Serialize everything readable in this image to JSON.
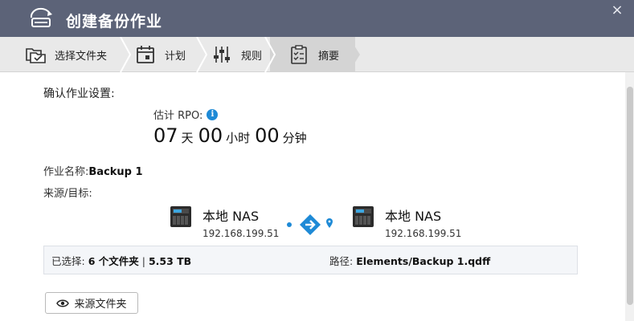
{
  "window": {
    "title": "创建备份作业",
    "close_symbol": "×"
  },
  "steps": [
    {
      "label": "选择文件夹",
      "icon": "folder-select-icon",
      "active": false
    },
    {
      "label": "计划",
      "icon": "calendar-icon",
      "active": false
    },
    {
      "label": "规则",
      "icon": "sliders-icon",
      "active": false
    },
    {
      "label": "摘要",
      "icon": "clipboard-icon",
      "active": true
    }
  ],
  "summary": {
    "heading": "确认作业设置:",
    "rpo": {
      "label": "估计 RPO:",
      "days": "07",
      "days_unit": "天",
      "hours": "00",
      "hours_unit": "小时",
      "minutes": "00",
      "minutes_unit": "分钟"
    },
    "job_name_label": "作业名称:",
    "job_name": "Backup 1",
    "source_target_label": "来源/目标:",
    "source": {
      "name": "本地 NAS",
      "ip": "192.168.199.51"
    },
    "target": {
      "name": "本地 NAS",
      "ip": "192.168.199.51"
    },
    "selected_label": "已选择:",
    "selected_value": "6 个文件夹",
    "selected_sep": "|",
    "selected_size": "5.53 TB",
    "path_label": "路径:",
    "path_value": "Elements/Backup 1.qdff",
    "source_folder_button": "来源文件夹"
  },
  "colors": {
    "titlebar": "#5c6378",
    "accent": "#1e8ad6",
    "step_bar": "#e9e9e9"
  }
}
